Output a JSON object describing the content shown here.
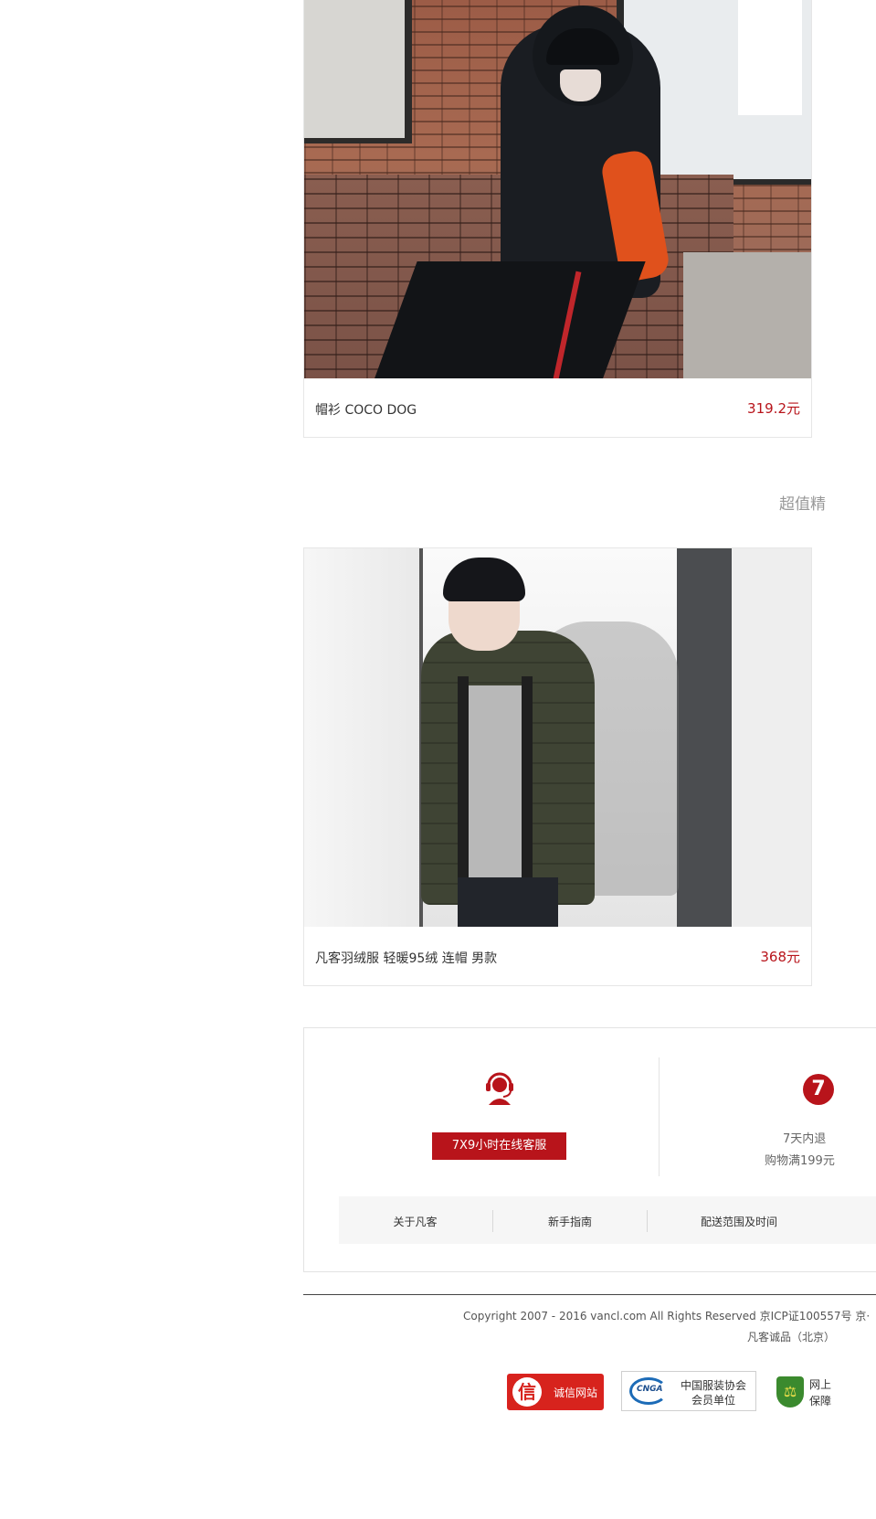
{
  "products": [
    {
      "name": "帽衫 COCO DOG",
      "price": "319.2元"
    },
    {
      "name": "凡客羽绒服 轻暖95绒 连帽 男款",
      "price": "368元"
    }
  ],
  "section": {
    "title": "超值精"
  },
  "service": {
    "online_service_button": "7X9小时在线客服",
    "seven_badge": "7",
    "policy_line1": "7天内退",
    "policy_line2": "购物满199元"
  },
  "footer_nav": [
    "关于凡客",
    "新手指南",
    "配送范围及时间"
  ],
  "footer": {
    "copyright": "Copyright 2007 - 2016 vancl.com All Rights Reserved 京ICP证100557号 京·",
    "company": "凡客诚品（北京）"
  },
  "badges": {
    "chengxin_logo": "信",
    "chengxin": "诚信网站",
    "cnga_logo": "CNGA",
    "cnga_line1": "中国服装协会",
    "cnga_line2": "会员单位",
    "shield_line1": "网上",
    "shield_line2": "保障"
  },
  "colors": {
    "accent": "#b8141b",
    "text": "#333333",
    "muted": "#999999"
  }
}
